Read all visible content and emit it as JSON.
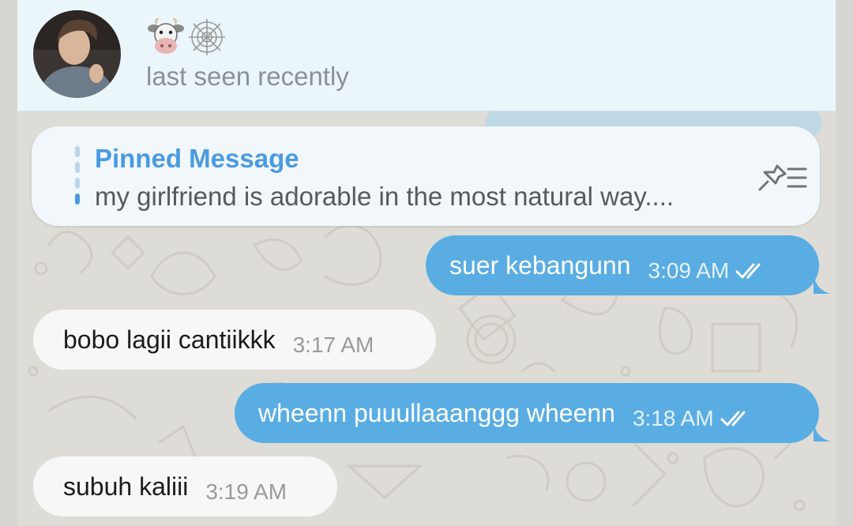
{
  "header": {
    "avatar_label": "avatar",
    "emojis": [
      "cow-face-icon",
      "spider-web-icon"
    ],
    "status": "last seen recently"
  },
  "pinned": {
    "title": "Pinned Message",
    "text": "my girlfriend is adorable in the most natural way...."
  },
  "messages": [
    {
      "direction": "out",
      "text": "suer kebangunn",
      "time": "3:09 AM",
      "read": true
    },
    {
      "direction": "in",
      "text": "bobo lagii cantiikkk",
      "time": "3:17 AM"
    },
    {
      "direction": "out",
      "text": "wheenn puuullaaanggg wheenn",
      "time": "3:18 AM",
      "read": true
    },
    {
      "direction": "in",
      "text": "subuh kaliii",
      "time": "3:19 AM"
    }
  ],
  "colors": {
    "outgoing_bubble": "#5aade3",
    "incoming_bubble": "#f7f7f7",
    "accent": "#4a9bdf",
    "header_bg": "#ebf6fb"
  }
}
